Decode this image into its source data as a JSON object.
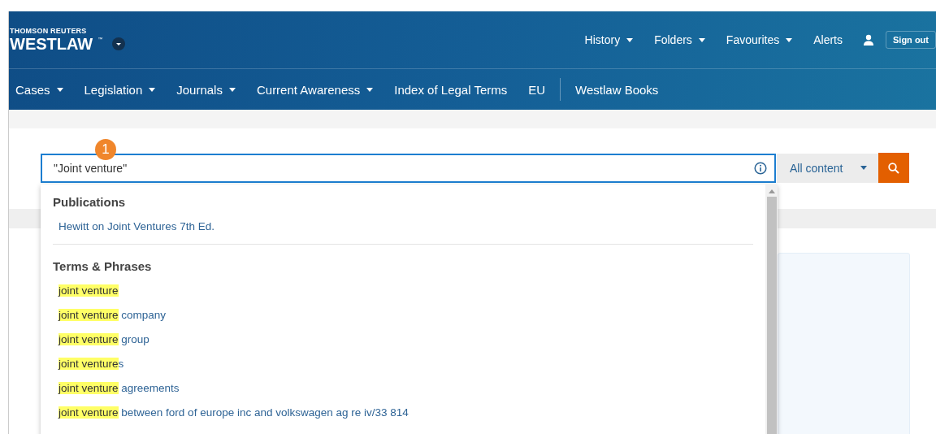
{
  "header": {
    "brand": "THOMSON REUTERS",
    "logo": "WESTLAW",
    "trademark": "™",
    "sign_out": "Sign out",
    "utility_nav": [
      {
        "label": "History",
        "dropdown": true
      },
      {
        "label": "Folders",
        "dropdown": true
      },
      {
        "label": "Favourites",
        "dropdown": true
      },
      {
        "label": "Alerts",
        "dropdown": false
      }
    ]
  },
  "main_nav": [
    {
      "label": "Cases",
      "dropdown": true,
      "divider_before": false
    },
    {
      "label": "Legislation",
      "dropdown": true,
      "divider_before": false
    },
    {
      "label": "Journals",
      "dropdown": true,
      "divider_before": false
    },
    {
      "label": "Current Awareness",
      "dropdown": true,
      "divider_before": false
    },
    {
      "label": "Index of Legal Terms",
      "dropdown": false,
      "divider_before": false
    },
    {
      "label": "EU",
      "dropdown": false,
      "divider_before": false
    },
    {
      "label": "Westlaw Books",
      "dropdown": false,
      "divider_before": true
    }
  ],
  "search": {
    "value": "\"Joint venture\"",
    "step_badge": "1",
    "scope": "All content"
  },
  "suggestions": [
    {
      "title": "Publications",
      "items": [
        {
          "parts": [
            {
              "text": "Hewitt on Joint Ventures 7th Ed.",
              "highlighted": false
            }
          ]
        }
      ]
    },
    {
      "title": "Terms & Phrases",
      "items": [
        {
          "parts": [
            {
              "text": "joint ",
              "highlighted": true
            },
            {
              "text": "venture",
              "highlighted": true
            }
          ]
        },
        {
          "parts": [
            {
              "text": "joint ",
              "highlighted": true
            },
            {
              "text": "venture",
              "highlighted": true
            },
            {
              "text": " company",
              "highlighted": false
            }
          ]
        },
        {
          "parts": [
            {
              "text": "joint ",
              "highlighted": true
            },
            {
              "text": "venture",
              "highlighted": true
            },
            {
              "text": " group",
              "highlighted": false
            }
          ]
        },
        {
          "parts": [
            {
              "text": "joint ",
              "highlighted": true
            },
            {
              "text": "venture",
              "highlighted": true
            },
            {
              "text": "s",
              "highlighted": false
            }
          ]
        },
        {
          "parts": [
            {
              "text": "joint ",
              "highlighted": true
            },
            {
              "text": "venture",
              "highlighted": true
            },
            {
              "text": " agreements",
              "highlighted": false
            }
          ]
        },
        {
          "parts": [
            {
              "text": "joint ",
              "highlighted": true
            },
            {
              "text": "venture",
              "highlighted": true
            },
            {
              "text": " between ford of europe inc and volkswagen ag re iv/33 814",
              "highlighted": false
            }
          ]
        }
      ]
    }
  ]
}
